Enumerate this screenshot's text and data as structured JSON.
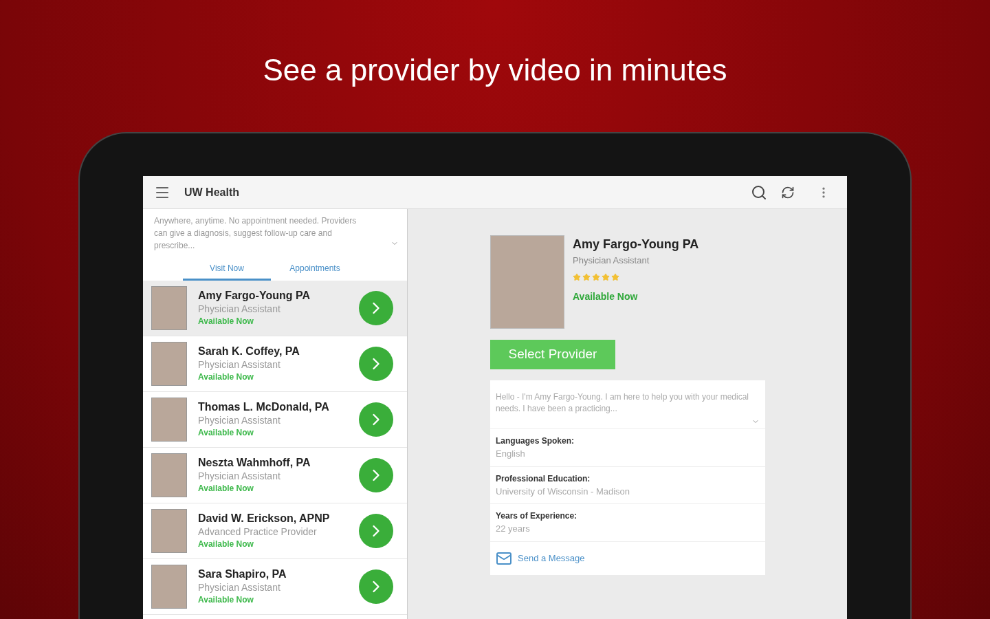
{
  "headline": "See a provider by video in minutes",
  "app_bar": {
    "title": "UW Health"
  },
  "intro": {
    "text": "Anywhere, anytime. No appointment needed. Providers can give a diagnosis, suggest follow-up care and prescribe..."
  },
  "tabs": [
    {
      "label": "Visit Now",
      "selected": true
    },
    {
      "label": "Appointments",
      "selected": false
    }
  ],
  "providers": [
    {
      "name": "Amy Fargo-Young PA",
      "role": "Physician Assistant",
      "status": "Available Now",
      "selected": true
    },
    {
      "name": "Sarah K. Coffey, PA",
      "role": "Physician Assistant",
      "status": "Available Now",
      "selected": false
    },
    {
      "name": "Thomas L. McDonald, PA",
      "role": "Physician Assistant",
      "status": "Available Now",
      "selected": false
    },
    {
      "name": "Neszta Wahmhoff, PA",
      "role": "Physician Assistant",
      "status": "Available Now",
      "selected": false
    },
    {
      "name": "David W. Erickson, APNP",
      "role": "Advanced Practice Provider",
      "status": "Available Now",
      "selected": false
    },
    {
      "name": "Sara Shapiro, PA",
      "role": "Physician Assistant",
      "status": "Available Now",
      "selected": false
    }
  ],
  "detail": {
    "name": "Amy Fargo-Young PA",
    "role": "Physician Assistant",
    "stars": 5,
    "status": "Available Now",
    "button": "Select Provider",
    "bio": "Hello - I'm Amy Fargo-Young. I am here to help you with your medical needs. I have been a practicing...",
    "facts": [
      {
        "label": "Languages Spoken:",
        "value": "English"
      },
      {
        "label": "Professional Education:",
        "value": "University of Wisconsin - Madison"
      },
      {
        "label": "Years of Experience:",
        "value": "22 years"
      }
    ],
    "message_link": "Send a Message"
  }
}
